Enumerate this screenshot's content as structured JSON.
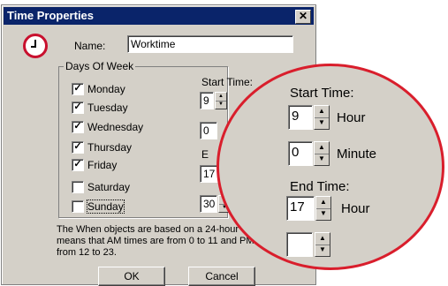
{
  "window": {
    "title": "Time Properties",
    "close_glyph": "✕"
  },
  "icon": {
    "name": "clock-icon"
  },
  "name_field": {
    "label": "Name:",
    "value": "Worktime"
  },
  "days": {
    "group_label": "Days Of Week",
    "items": [
      {
        "label": "Monday",
        "checked": true
      },
      {
        "label": "Tuesday",
        "checked": true
      },
      {
        "label": "Wednesday",
        "checked": true
      },
      {
        "label": "Thursday",
        "checked": true
      },
      {
        "label": "Friday",
        "checked": true
      },
      {
        "label": "Saturday",
        "checked": false
      },
      {
        "label": "Sunday",
        "checked": false
      }
    ]
  },
  "start_time": {
    "label": "Start Time:",
    "hour": "9",
    "minute": "0"
  },
  "end_time": {
    "label_partial": "E",
    "hour": "17",
    "minute": "30"
  },
  "note": "The When objects are based on a 24-hour clock. This means that AM times are from 0 to 11 and PM times are from 12 to 23.",
  "buttons": {
    "ok": "OK",
    "cancel": "Cancel"
  },
  "zoom": {
    "start_label": "Start Time:",
    "start_hour": "9",
    "hour_label": "Hour",
    "start_minute": "0",
    "minute_label": "Minute",
    "end_label": "End Time:",
    "end_hour": "17",
    "end_hour_label": "Hour"
  },
  "colors": {
    "title_bar": "#0a246a",
    "dialog_bg": "#d4d0c8",
    "highlight_ring": "#d91e2c"
  }
}
